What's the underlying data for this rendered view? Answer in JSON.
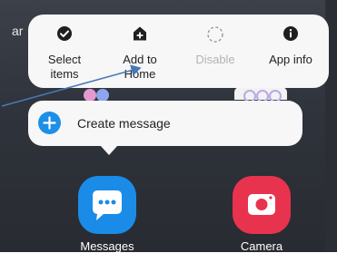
{
  "background": {
    "partial_text": "ar"
  },
  "context_menu": {
    "items": [
      {
        "label_line1": "Select",
        "label_line2": "items",
        "icon": "check-circle-icon",
        "enabled": true
      },
      {
        "label_line1": "Add to",
        "label_line2": "Home",
        "icon": "add-home-icon",
        "enabled": true
      },
      {
        "label_line1": "Disable",
        "label_line2": "",
        "icon": "dashed-circle-icon",
        "enabled": false
      },
      {
        "label_line1": "App info",
        "label_line2": "",
        "icon": "info-circle-icon",
        "enabled": true
      }
    ]
  },
  "shortcut_popup": {
    "label": "Create message",
    "icon": "plus-circle-icon"
  },
  "dock": {
    "apps": [
      {
        "label": "Messages",
        "icon": "chat-bubble-icon",
        "color": "#1a8ce8"
      },
      {
        "label": "Camera",
        "icon": "camera-icon",
        "color": "#e8334f"
      }
    ]
  },
  "annotation": {
    "arrow_color": "#4a78b8"
  },
  "colors": {
    "accent": "#1d8fe6",
    "disabled_text": "#b3b3b3",
    "card": "#f7f7f7"
  }
}
